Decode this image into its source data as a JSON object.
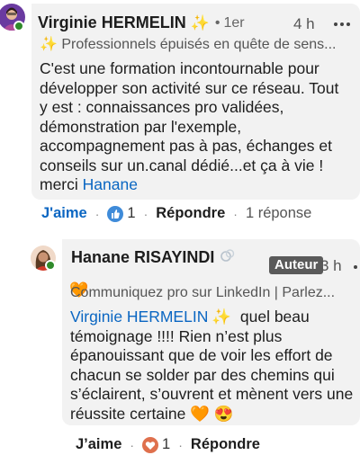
{
  "comment": {
    "author": "Virginie HERMELIN",
    "badge_icon": "✨",
    "separator": "•",
    "degree": "1er",
    "time": "4 h",
    "headline": "✨ Professionnels épuisés en quête de sens...",
    "body_lines": [
      "C'est une formation incontournable pour",
      "développer son activité sur ce réseau.  Tout",
      "y est : connaissances pro validées,",
      "démonstration par l'exemple,",
      "accompagnement pas à pas,  échanges et",
      "conseils sur un.canal dédié...et ça à vie !",
      "merci "
    ],
    "mention": "Hanane",
    "actions": {
      "like": "J'aime",
      "separator": "·",
      "reaction_count": "1",
      "reply": "Répondre",
      "reply_count": "1 réponse"
    }
  },
  "reply": {
    "author": "Hanane RISAYINDI",
    "name_icon": "rings-icon",
    "heart": "🧡",
    "badge": "Auteur",
    "time": "3 h",
    "headline": "Communiquez pro sur LinkedIn | Parlez...",
    "mention": "Virginie HERMELIN",
    "sparkle": "✨",
    "body_first": "  quel beau",
    "body_lines": [
      "témoignage !!!! Rien n’est plus",
      "épanouissant que de voir les effort de",
      "chacun se solder par des chemins qui",
      "s’éclairent, s’ouvrent et mènent vers une",
      "réussite certaine 🧡 😍"
    ],
    "actions": {
      "like": "J’aime",
      "separator": "·",
      "reaction_count": "1",
      "reply": "Répondre"
    }
  },
  "colors": {
    "link_blue": "#0a66c2",
    "bubble_bg": "#f2f2f2",
    "online_green": "#2f8a2a",
    "badge_bg": "#5a5a5a"
  }
}
